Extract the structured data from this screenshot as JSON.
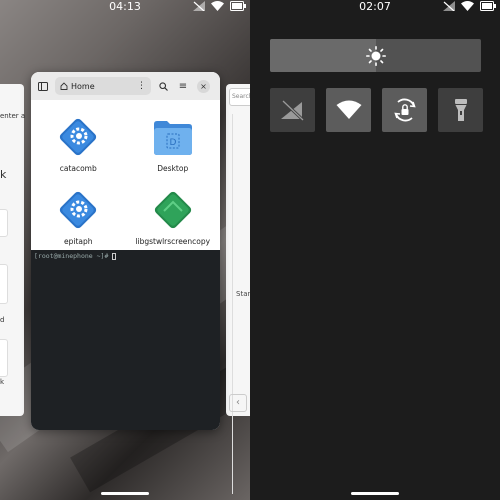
{
  "left_phone": {
    "status": {
      "time": "04:13"
    },
    "bg_card_left": {
      "fragments": [
        "enter a",
        "k",
        "d",
        "k"
      ]
    },
    "bg_card_right": {
      "search_placeholder": "Search",
      "fragment": "Stan"
    },
    "file_manager": {
      "location": "Home",
      "files": [
        {
          "name": "catacomb",
          "icon": "app-gear-icon",
          "color": "#2a73c8"
        },
        {
          "name": "Desktop",
          "icon": "folder-icon",
          "color": "#5aa3e6"
        },
        {
          "name": "epitaph",
          "icon": "app-gear-icon",
          "color": "#2a73c8"
        },
        {
          "name": "libgstwlrscreencopy",
          "icon": "app-diamond-icon",
          "color": "#2fa35a"
        }
      ]
    },
    "terminal": {
      "prompt": "[root@minephone ~]# "
    }
  },
  "right_phone": {
    "status": {
      "time": "02:07"
    },
    "brightness_level": 0.5,
    "quick_settings": [
      {
        "name": "mobile-data-toggle",
        "icon": "mobile-data-off-icon",
        "state": "off"
      },
      {
        "name": "wifi-toggle",
        "icon": "wifi-icon",
        "state": "on"
      },
      {
        "name": "rotation-lock-toggle",
        "icon": "rotation-lock-icon",
        "state": "on"
      },
      {
        "name": "flashlight-toggle",
        "icon": "flashlight-icon",
        "state": "off"
      }
    ]
  }
}
